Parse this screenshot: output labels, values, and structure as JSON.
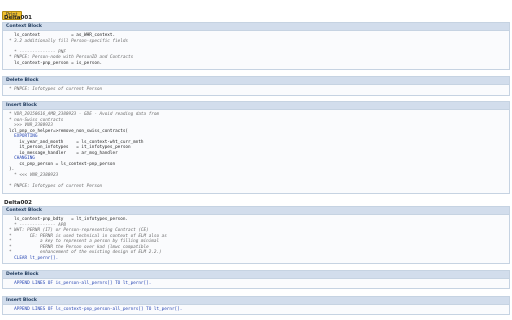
{
  "toolbar": {
    "print_label": "Print"
  },
  "sections": [
    {
      "title": "Delta001",
      "blocks": [
        {
          "header": "Context Block",
          "lines": [
            {
              "t": "  ls_context            = as_WHR_context.",
              "c": "normal"
            },
            {
              "t": "* 3.2 additionally fill Person-specific fields",
              "c": "comment"
            },
            {
              "t": "",
              "c": "normal"
            },
            {
              "t": "  * -------------- PNF",
              "c": "comment"
            },
            {
              "t": "* PNPCE: Person-node with PersonID and Contracts",
              "c": "comment"
            },
            {
              "t": "  ls_context-pnp_person = is_person.",
              "c": "normal"
            }
          ]
        },
        {
          "header": "Delete Block",
          "lines": [
            {
              "t": "* PNPCE: Infotypes of current Person",
              "c": "comment"
            }
          ]
        },
        {
          "header": "Insert Block",
          "lines": [
            {
              "t": "* VDR_20150616_AMB_2380923 - GDE - Avoid reading data from",
              "c": "comment"
            },
            {
              "t": "* non-Swiss contracts",
              "c": "comment"
            },
            {
              "t": "  >>> VNR_2380923",
              "c": "comment"
            },
            {
              "t": "lcl_pnp_ce_helper=>remove_non_swiss_contracts(",
              "c": "normal"
            },
            {
              "t": "  EXPORTING",
              "c": "keyword"
            },
            {
              "t": "    iv_year_and_month     = ls_context-wht_curr_mnth",
              "c": "normal"
            },
            {
              "t": "    it_person_infotypes   = it_infotypes_person",
              "c": "normal"
            },
            {
              "t": "    io_message_handler    = ar_msg_handler",
              "c": "normal"
            },
            {
              "t": "  CHANGING",
              "c": "keyword"
            },
            {
              "t": "    cs_pnp_person = ls_context-pnp_person",
              "c": "normal"
            },
            {
              "t": ").",
              "c": "normal"
            },
            {
              "t": "  * <<< VNR_2380923",
              "c": "comment"
            },
            {
              "t": "",
              "c": "normal"
            },
            {
              "t": "* PNPCE: Infotypes of current Person",
              "c": "comment"
            }
          ]
        }
      ]
    },
    {
      "title": "Delta002",
      "blocks": [
        {
          "header": "Context Block",
          "lines": [
            {
              "t": "  ls_context-pnp_bdty   = lt_infotypes_person.",
              "c": "normal"
            },
            {
              "t": "  * -------------- APB",
              "c": "comment"
            },
            {
              "t": "* WHT: PERNR (IT) or Person-representing Contract (CE)",
              "c": "comment"
            },
            {
              "t": "*       CE: PERNR is used technical in context of ELM also as",
              "c": "comment"
            },
            {
              "t": "*           a key to represent a person by filling minimal",
              "c": "comment"
            },
            {
              "t": "*           PERNR the Person over kad (lmwc compatible",
              "c": "comment"
            },
            {
              "t": "*           enhancement of the existing design of ELM 2.2.)",
              "c": "comment"
            },
            {
              "t": "  CLEAR lt_pernr[].",
              "c": "keyword"
            }
          ]
        },
        {
          "header": "Delete Block",
          "lines": [
            {
              "t": "  APPEND LINES OF is_person-all_pernrs[] TO lt_pernr[].",
              "c": "keyword"
            }
          ]
        },
        {
          "header": "Insert Block",
          "lines": [
            {
              "t": "  APPEND LINES OF ls_context-pnp_person-all_pernrs[] TO lt_pernr[].",
              "c": "keyword"
            }
          ]
        }
      ]
    }
  ]
}
